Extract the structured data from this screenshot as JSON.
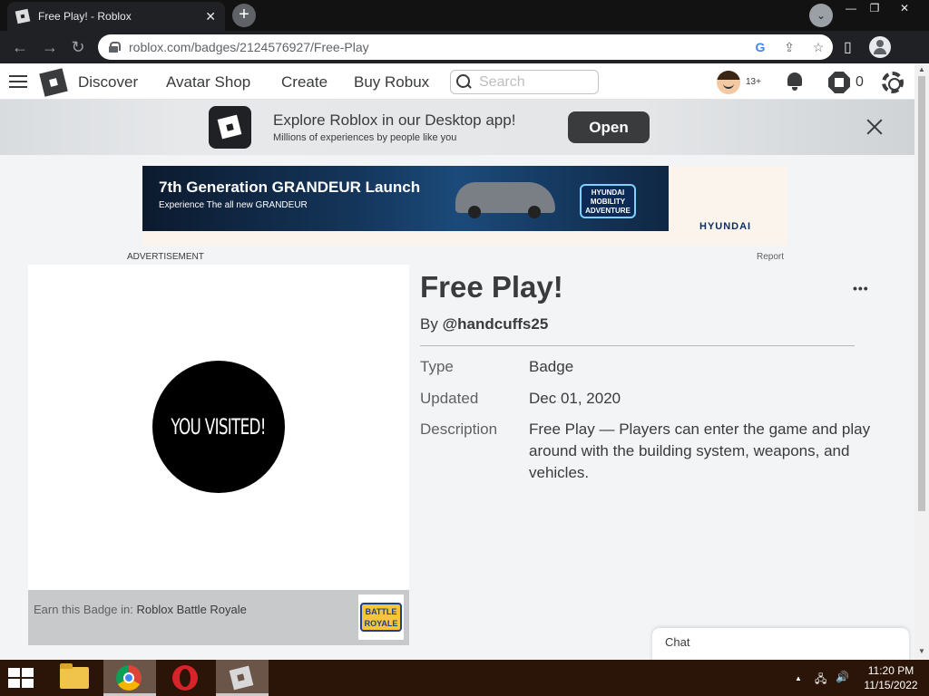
{
  "browser": {
    "tab_title": "Free Play! - Roblox",
    "tab_close": "✕",
    "new_tab": "+",
    "tab_search": "⌄",
    "window_controls": {
      "minimize": "—",
      "restore": "❐",
      "close": "✕"
    },
    "back": "←",
    "forward": "→",
    "reload": "↻",
    "url": "roblox.com/badges/2124576927/Free-Play",
    "google_icon": "G",
    "share_icon": "⇪",
    "bookmark_icon": "☆",
    "sidepanel_icon": "▯"
  },
  "header": {
    "nav": [
      "Discover",
      "Avatar Shop",
      "Create",
      "Buy Robux"
    ],
    "search_placeholder": "Search",
    "age": "13+",
    "robux": "0"
  },
  "app_banner": {
    "title": "Explore Roblox in our Desktop app!",
    "subtitle": "Millions of experiences by people like you",
    "open_label": "Open"
  },
  "ad": {
    "headline": "7th Generation GRANDEUR Launch",
    "subline": "Experience The all new GRANDEUR",
    "game_logo": "HYUNDAI MOBILITY ADVENTURE",
    "brand": "HYUNDAI",
    "label": "ADVERTISEMENT",
    "report": "Report"
  },
  "badge": {
    "image_text": "YOU VISITED!",
    "earn_prefix": "Earn this Badge in:",
    "earn_game": "Roblox Battle Royale",
    "game_thumb_text": "BATTLE ROYALE",
    "title": "Free Play!",
    "menu": "•••",
    "by": "By",
    "creator": "@handcuffs25",
    "rows": [
      {
        "label": "Type",
        "value": "Badge"
      },
      {
        "label": "Updated",
        "value": "Dec 01, 2020"
      },
      {
        "label": "Description",
        "value": "Free Play — Players can enter the game and play around with the building system, weapons, and vehicles."
      }
    ]
  },
  "chat": {
    "label": "Chat"
  },
  "taskbar": {
    "tray_up": "▲",
    "network": "🖧",
    "volume": "🔊",
    "time": "11:20 PM",
    "date": "11/15/2022"
  },
  "scroll": {
    "up": "▲",
    "down": "▼"
  }
}
